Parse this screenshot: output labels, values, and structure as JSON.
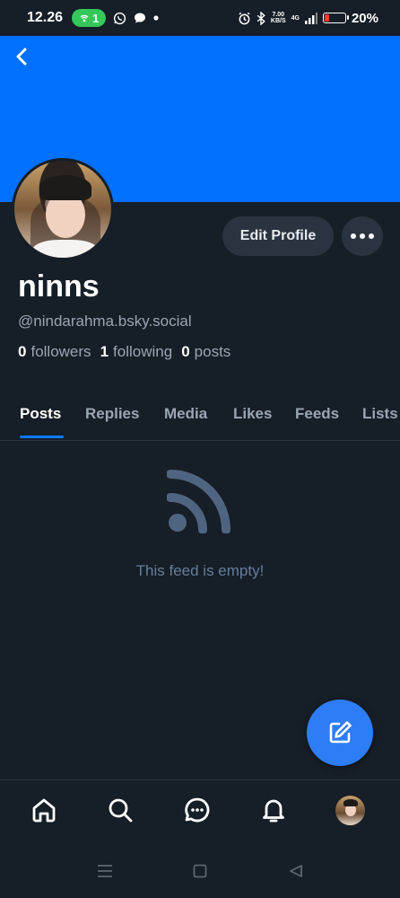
{
  "status_bar": {
    "time": "12.26",
    "hotspot_count": "1",
    "net_speed_value": "7.00",
    "net_speed_unit": "KB/S",
    "network_type": "4G",
    "battery_percent": "20%",
    "battery_level": 0.2
  },
  "profile": {
    "display_name": "ninns",
    "handle": "@nindarahma.bsky.social",
    "followers_count": "0",
    "followers_label": "followers",
    "following_count": "1",
    "following_label": "following",
    "posts_count": "0",
    "posts_label": "posts",
    "edit_label": "Edit Profile",
    "banner_color": "#0070ff"
  },
  "tabs": [
    {
      "label": "Posts",
      "active": true
    },
    {
      "label": "Replies",
      "active": false
    },
    {
      "label": "Media",
      "active": false
    },
    {
      "label": "Likes",
      "active": false
    },
    {
      "label": "Feeds",
      "active": false
    },
    {
      "label": "Lists",
      "active": false
    }
  ],
  "feed": {
    "empty_message": "This feed is empty!"
  },
  "bottom_nav": [
    "home-icon",
    "search-icon",
    "chat-icon",
    "bell-icon",
    "profile-avatar"
  ],
  "colors": {
    "background": "#161e27",
    "accent": "#0a7aff",
    "fab": "#2e7cf6",
    "muted": "#9aa6b3"
  }
}
